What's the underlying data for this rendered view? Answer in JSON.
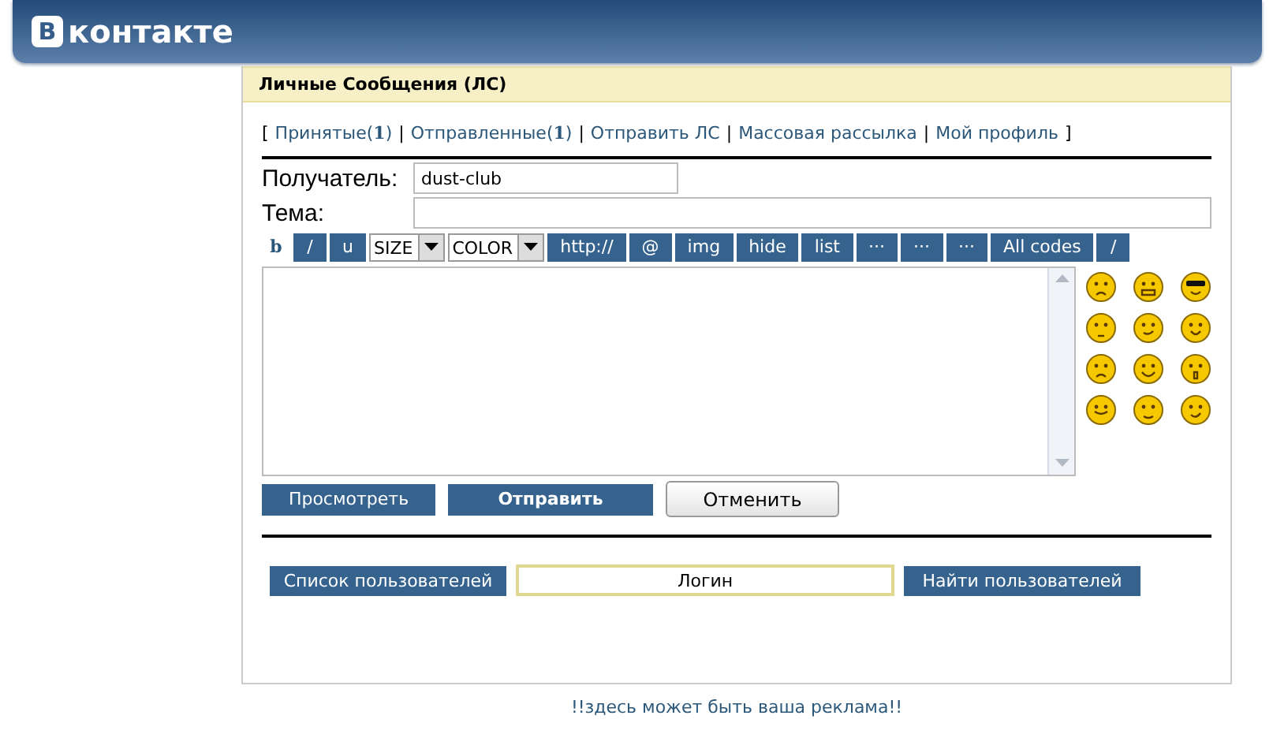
{
  "header": {
    "logo_letter": "В",
    "logo_text": "контакте"
  },
  "panel": {
    "title": "Личные Сообщения (ЛС)"
  },
  "nav": {
    "open": "[",
    "close": "]",
    "separator": "|",
    "links": [
      {
        "label": "Принятые(**1**)"
      },
      {
        "label": "Отправленные(**1**)"
      },
      {
        "label": "Отправить ЛС"
      },
      {
        "label": "Массовая рассылка"
      },
      {
        "label": "Мой профиль"
      }
    ]
  },
  "recipient": {
    "label": "Получатель:",
    "value": "dust-club"
  },
  "subject": {
    "label": "Тема:"
  },
  "toolbar": [
    {
      "kind": "plain",
      "label": "b"
    },
    {
      "kind": "button",
      "label": "/"
    },
    {
      "kind": "button",
      "label": "u"
    },
    {
      "kind": "select",
      "label": "SIZE"
    },
    {
      "kind": "select",
      "label": "COLOR"
    },
    {
      "kind": "button",
      "label": "http://"
    },
    {
      "kind": "button",
      "label": "@"
    },
    {
      "kind": "button",
      "label": "img"
    },
    {
      "kind": "button",
      "label": "hide"
    },
    {
      "kind": "button",
      "label": "list"
    },
    {
      "kind": "button",
      "label": "···"
    },
    {
      "kind": "button",
      "label": "···"
    },
    {
      "kind": "button",
      "label": "···"
    },
    {
      "kind": "button",
      "label": "All codes"
    },
    {
      "kind": "button",
      "label": "/"
    }
  ],
  "actions": [
    {
      "kind": "primary",
      "label": "Просмотреть"
    },
    {
      "kind": "bold",
      "label": "Отправить"
    },
    {
      "kind": "plain",
      "label": "Отменить"
    }
  ],
  "search": {
    "list_button": "Список пользователей",
    "value": "Логин",
    "find_button": "Найти пользователей"
  },
  "footer": {
    "ad": "!!здесь может быть ваша реклама!!"
  }
}
